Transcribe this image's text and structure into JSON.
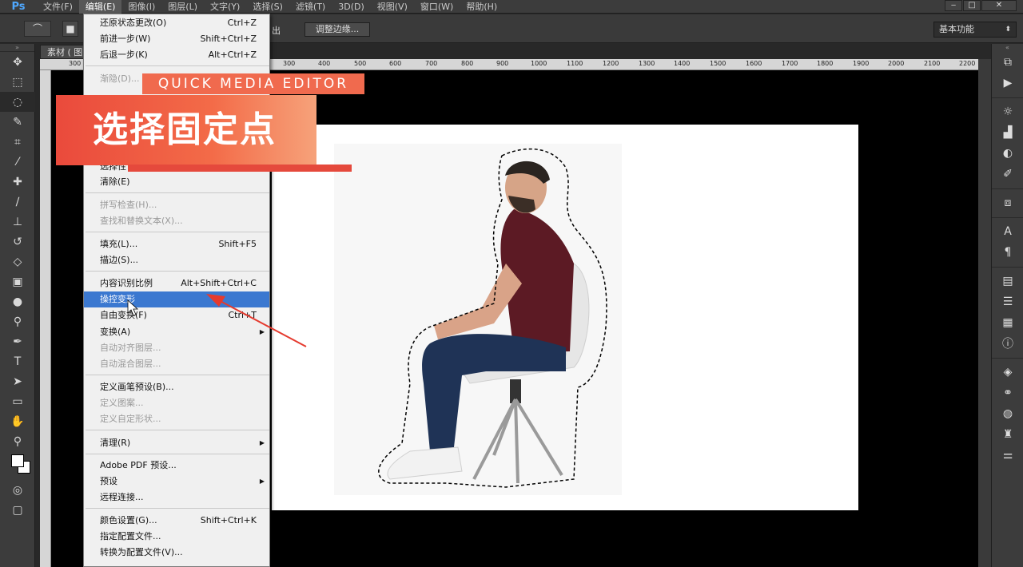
{
  "app": {
    "logo": "Ps"
  },
  "menubar": {
    "items": [
      "文件(F)",
      "编辑(E)",
      "图像(I)",
      "图层(L)",
      "文字(Y)",
      "选择(S)",
      "滤镜(T)",
      "3D(D)",
      "视图(V)",
      "窗口(W)",
      "帮助(H)"
    ],
    "active_index": 1
  },
  "window_controls": {
    "minimize": "‒",
    "maximize": "□",
    "close": "✕"
  },
  "options_bar": {
    "partial_label": "出",
    "refine_edge_label": "调整边缘...",
    "workspace_label": "基本功能"
  },
  "document": {
    "tab_title": "素材 ( 图"
  },
  "ruler": {
    "ticks": [
      "300",
      "300",
      "400",
      "500",
      "600",
      "700",
      "800",
      "900",
      "1000",
      "1100",
      "1200",
      "1300",
      "1400",
      "1500",
      "1600",
      "1700",
      "1800",
      "1900",
      "2000",
      "2100",
      "2200"
    ],
    "left_tick": "300"
  },
  "edit_menu": {
    "items": [
      {
        "label": "还原状态更改(O)",
        "shortcut": "Ctrl+Z",
        "disabled": false
      },
      {
        "label": "前进一步(W)",
        "shortcut": "Shift+Ctrl+Z",
        "disabled": false
      },
      {
        "label": "后退一步(K)",
        "shortcut": "Alt+Ctrl+Z",
        "disabled": false
      },
      {
        "label": "渐隐(D)...",
        "shortcut": "",
        "disabled": true
      },
      {
        "label": "选择性",
        "shortcut": "",
        "disabled": false
      },
      {
        "label": "清除(E)",
        "shortcut": "",
        "disabled": false
      },
      {
        "label": "拼写检查(H)...",
        "shortcut": "",
        "disabled": true
      },
      {
        "label": "查找和替换文本(X)...",
        "shortcut": "",
        "disabled": true
      },
      {
        "label": "填充(L)...",
        "shortcut": "Shift+F5",
        "disabled": false
      },
      {
        "label": "描边(S)...",
        "shortcut": "",
        "disabled": false
      },
      {
        "label": "内容识别比例",
        "shortcut": "Alt+Shift+Ctrl+C",
        "disabled": false
      },
      {
        "label": "操控变形",
        "shortcut": "",
        "disabled": false,
        "highlight": true
      },
      {
        "label": "自由变换(F)",
        "shortcut": "Ctrl+T",
        "disabled": false
      },
      {
        "label": "变换(A)",
        "shortcut": "",
        "disabled": false,
        "submenu": true
      },
      {
        "label": "自动对齐图层...",
        "shortcut": "",
        "disabled": true
      },
      {
        "label": "自动混合图层...",
        "shortcut": "",
        "disabled": true
      },
      {
        "label": "定义画笔预设(B)...",
        "shortcut": "",
        "disabled": false
      },
      {
        "label": "定义图案...",
        "shortcut": "",
        "disabled": true
      },
      {
        "label": "定义自定形状...",
        "shortcut": "",
        "disabled": true
      },
      {
        "label": "清理(R)",
        "shortcut": "",
        "disabled": false,
        "submenu": true
      },
      {
        "label": "Adobe PDF 预设...",
        "shortcut": "",
        "disabled": false
      },
      {
        "label": "预设",
        "shortcut": "",
        "disabled": false,
        "submenu": true
      },
      {
        "label": "远程连接...",
        "shortcut": "",
        "disabled": false
      },
      {
        "label": "颜色设置(G)...",
        "shortcut": "Shift+Ctrl+K",
        "disabled": false
      },
      {
        "label": "指定配置文件...",
        "shortcut": "",
        "disabled": false
      },
      {
        "label": "转换为配置文件(V)...",
        "shortcut": "",
        "disabled": false
      }
    ]
  },
  "overlay": {
    "brand": "QUICK MEDIA EDITOR",
    "title": "选择固定点"
  },
  "colors": {
    "accent_banner": "#f06a4e",
    "menu_highlight": "#3b78d0",
    "arrow": "#e53a2e"
  },
  "tools": [
    "move-icon",
    "marquee-icon",
    "lasso-icon",
    "quick-select-icon",
    "crop-icon",
    "eyedropper-icon",
    "healing-icon",
    "brush-icon",
    "stamp-icon",
    "history-brush-icon",
    "eraser-icon",
    "gradient-icon",
    "blur-icon",
    "dodge-icon",
    "pen-icon",
    "type-icon",
    "path-select-icon",
    "shape-icon",
    "hand-icon",
    "zoom-icon"
  ],
  "panels": [
    "history-icon",
    "play-icon",
    "adjust-icon",
    "histogram-icon",
    "navigator-icon",
    "brush-panel-icon",
    "clone-source-icon",
    "character-icon",
    "paragraph-icon",
    "styles-icon",
    "notes-icon",
    "swatches-icon",
    "info-icon",
    "layers-icon",
    "paths-icon",
    "channels-icon",
    "properties-icon",
    "tool-presets-icon"
  ]
}
